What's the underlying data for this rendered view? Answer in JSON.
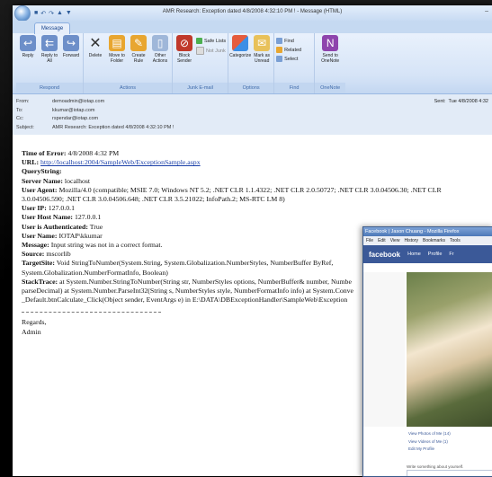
{
  "window": {
    "title": "AMR Research: Exception dated 4/8/2008 4:32:10 PM ! - Message (HTML)",
    "tab": "Message"
  },
  "ribbon": {
    "groups": [
      {
        "name": "Respond",
        "buttons": [
          "Reply",
          "Reply to All",
          "Forward"
        ]
      },
      {
        "name": "Actions",
        "buttons": [
          "Delete",
          "Move to Folder",
          "Create Rule",
          "Other Actions"
        ]
      },
      {
        "name": "Junk E-mail",
        "buttons": [
          "Block Sender"
        ],
        "stack": [
          "Safe Lists",
          "Not Junk"
        ]
      },
      {
        "name": "Options",
        "buttons": [
          "Categorize",
          "Mark as Unread"
        ]
      },
      {
        "name": "Find",
        "stack": [
          "Find",
          "Related",
          "Select"
        ]
      },
      {
        "name": "OneNote",
        "buttons": [
          "Send to OneNote"
        ]
      }
    ],
    "colors": {
      "reply": "#6d8fc9",
      "delete": "#333333",
      "move": "#e8a630",
      "block": "#c0392b",
      "categorize": "#e55b3c",
      "onenote": "#8e44ad"
    }
  },
  "header": {
    "from_label": "From:",
    "from": "demoadmin@iotap.com",
    "to_label": "To:",
    "to": "kkumar@iotap.com",
    "cc_label": "Cc:",
    "cc": "rspendar@iotap.com",
    "subject_label": "Subject:",
    "subject": "AMR Research: Exception dated 4/8/2008 4:32:10 PM !",
    "sent_label": "Sent:",
    "sent": "Tue 4/8/2008 4:32"
  },
  "body": {
    "time_k": "Time of Error:",
    "time_v": "4/8/2008 4:32 PM",
    "url_k": "URL:",
    "url_v": "http://localhost:2004/SampleWeb/ExceptionSample.aspx",
    "qs_k": "QueryString:",
    "server_k": "Server Name:",
    "server_v": "localhost",
    "agent_k": "User Agent:",
    "agent_v": "Mozilla/4.0 (compatible; MSIE 7.0; Windows NT 5.2; .NET CLR 1.1.4322; .NET CLR 2.0.50727; .NET CLR 3.0.04506.30; .NET CLR",
    "agent_v2": "3.0.04506.590; .NET CLR 3.0.04506.648; .NET CLR 3.5.21022; InfoPath.2; MS-RTC LM 8)",
    "ip_k": "User IP:",
    "ip_v": "127.0.0.1",
    "host_k": "User Host Name:",
    "host_v": "127.0.0.1",
    "auth_k": "User is Authenticated:",
    "auth_v": "True",
    "user_k": "User Name:",
    "user_v": "IOTAP\\kkumar",
    "msg_k": "Message:",
    "msg_v": "Input string was not in a correct format.",
    "src_k": "Source:",
    "src_v": "mscorlib",
    "target_k": "TargetSite:",
    "target_v": "Void StringToNumber(System.String, System.Globalization.NumberStyles, NumberBuffer ByRef,",
    "target_v2": "System.Globalization.NumberFormatInfo, Boolean)",
    "stack_k": "StackTrace:",
    "stack_v": "at System.Number.StringToNumber(String str, NumberStyles options, NumberBuffer& number, Numbe",
    "stack_v2": "parseDecimal) at System.Number.ParseInt32(String s, NumberStyles style, NumberFormatInfo info) at System.Conve",
    "stack_v3": "_Default.btnCalculate_Click(Object sender, EventArgs e) in E:\\DATA\\DBExceptionHandler\\SampleWeb\\Exception",
    "regards": "Regards,",
    "sign": "Admin"
  },
  "facebook": {
    "title": "Facebook | Jason Chuang - Mozilla Firefox",
    "menu": [
      "File",
      "Edit",
      "View",
      "History",
      "Bookmarks",
      "Tools"
    ],
    "logo": "facebook",
    "nav": [
      "Home",
      "Profile",
      "Fr"
    ],
    "links": [
      "View Photos of Me (14)",
      "View Videos of Me (1)",
      "Edit My Profile"
    ],
    "prompt": "Write something about yourself."
  }
}
